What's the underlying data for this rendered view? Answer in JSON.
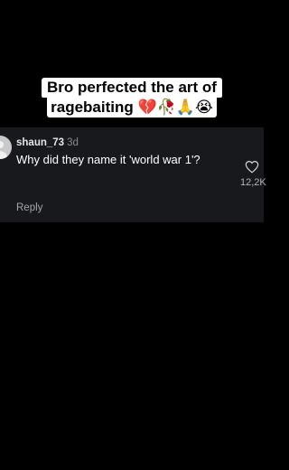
{
  "caption": {
    "line1": "Bro perfected the art of",
    "line2": "ragebaiting 💔🥀🙏😭"
  },
  "comment": {
    "username": "shaun_73",
    "time": "3d",
    "text": "Why did they name it 'world war 1'?",
    "likes": "12,2K",
    "reply_label": "Reply"
  },
  "icons": {
    "like": "heart-outline-icon",
    "avatar": "default-avatar-icon"
  },
  "colors": {
    "background": "#000000",
    "card": "#17191d",
    "caption_bg": "#ffffff"
  }
}
